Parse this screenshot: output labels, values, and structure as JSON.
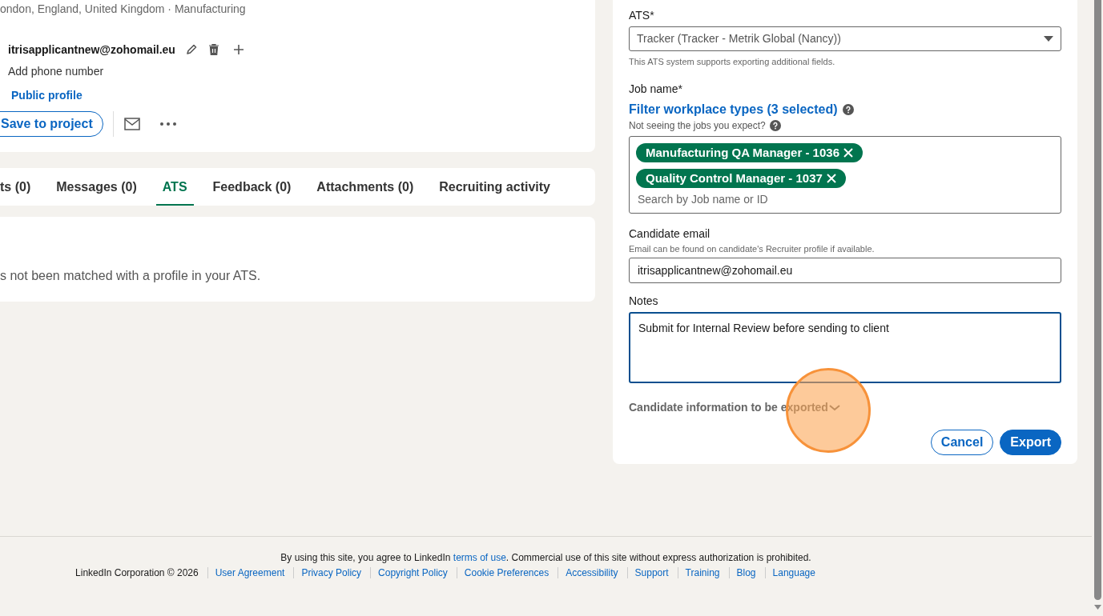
{
  "profile": {
    "location": "ondon, England, United Kingdom · Manufacturing",
    "email": "itrisapplicantnew@zohomail.eu",
    "phone_prompt": "Add phone number",
    "public_profile": "Public profile",
    "save_button": "Save to project"
  },
  "tabs": [
    {
      "label": "ts (0)",
      "selected": false
    },
    {
      "label": "Messages (0)",
      "selected": false
    },
    {
      "label": "ATS",
      "selected": true
    },
    {
      "label": "Feedback (0)",
      "selected": false
    },
    {
      "label": "Attachments (0)",
      "selected": false
    },
    {
      "label": "Recruiting activity",
      "selected": false
    }
  ],
  "ats_message": "s not been matched with a profile in your ATS.",
  "export_form": {
    "ats_label": "ATS*",
    "ats_value": "Tracker (Tracker - Metrik Global (Nancy))",
    "ats_hint": "This ATS system supports exporting additional fields.",
    "job_label": "Job name*",
    "filter_link": "Filter workplace types (3 selected)",
    "job_hint": "Not seeing the jobs you expect?",
    "jobs": [
      {
        "label": "Manufacturing QA Manager - 1036"
      },
      {
        "label": "Quality Control Manager - 1037"
      }
    ],
    "job_search_placeholder": "Search by Job name or ID",
    "email_label": "Candidate email",
    "email_hint": "Email can be found on candidate's Recruiter profile if available.",
    "email_value": "itrisapplicantnew@zohomail.eu",
    "notes_label": "Notes",
    "notes_value": "Submit for Internal Review before sending to client",
    "notes_focused": true,
    "export_info": "Candidate information to be exported",
    "export_info_expanded": false,
    "buttons": [
      {
        "label": "Cancel",
        "kind": "secondary"
      },
      {
        "label": "Export",
        "kind": "primary"
      }
    ]
  },
  "footer": {
    "notice_before": "By using this site, you agree to LinkedIn ",
    "notice_link": "terms of use",
    "notice_after": ". Commercial use of this site without express authorization is prohibited.",
    "copyright": "LinkedIn Corporation © 2026",
    "links": [
      "User Agreement",
      "Privacy Policy",
      "Copyright Policy",
      "Cookie Preferences",
      "Accessibility",
      "Support",
      "Training",
      "Blog",
      "Language"
    ]
  }
}
